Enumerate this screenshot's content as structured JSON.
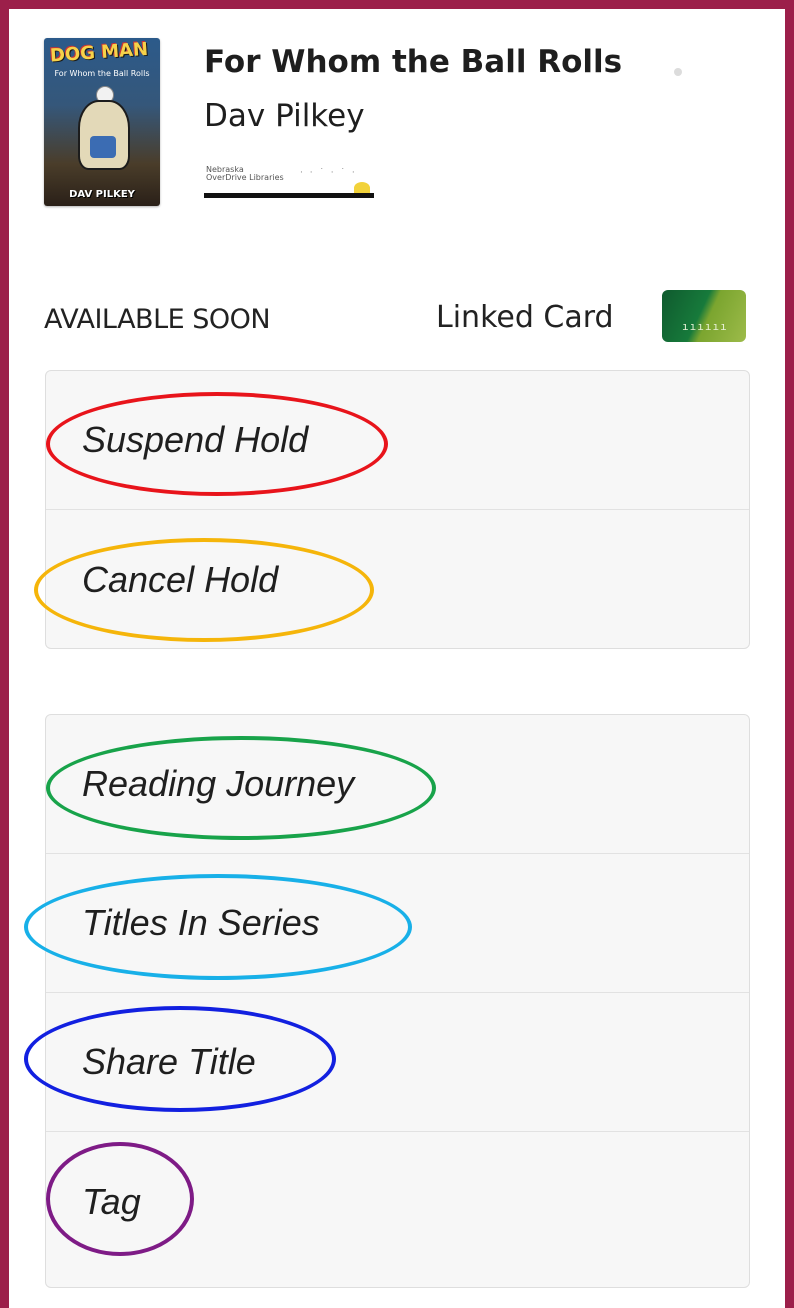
{
  "book": {
    "title": "For Whom the Ball Rolls",
    "author": "Dav Pilkey",
    "cover": {
      "series_text": "DOG MAN",
      "subtitle_text": "For Whom the Ball Rolls",
      "author_text": "DAV PILKEY"
    },
    "library": {
      "name": "Nebraska\nOverDrive Libraries"
    }
  },
  "status": {
    "availability": "AVAILABLE SOON",
    "card_label": "Linked Card",
    "card_icon": "library-card-icon"
  },
  "actions_primary": [
    {
      "label": "Suspend Hold",
      "highlight_color": "#e8141b"
    },
    {
      "label": "Cancel Hold",
      "highlight_color": "#f5b50a"
    }
  ],
  "actions_secondary": [
    {
      "label": "Reading Journey",
      "highlight_color": "#18a34a"
    },
    {
      "label": "Titles In Series",
      "highlight_color": "#18b0e8"
    },
    {
      "label": "Share Title",
      "highlight_color": "#1220e0"
    },
    {
      "label": "Tag",
      "highlight_color": "#7e1b86"
    }
  ],
  "theme": {
    "frame_color": "#9c1f4a"
  }
}
